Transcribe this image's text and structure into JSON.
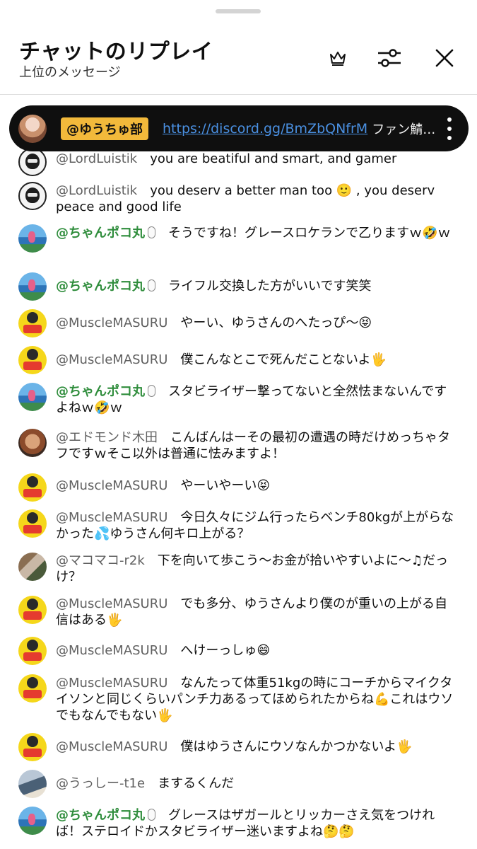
{
  "header": {
    "title": "チャットのリプレイ",
    "subtitle": "上位のメッセージ"
  },
  "pinned": {
    "author": "@ゆうちゅ部",
    "link": "https://discord.gg/BmZbQNfrM",
    "text": "ファン鯖…"
  },
  "messages": [
    {
      "author": "@LordLuistik",
      "text": "you are beatiful and smart, and gamer"
    },
    {
      "author": "@LordLuistik",
      "text": "you deserv a better man too 🙂 , you deserv peace and good life"
    },
    {
      "author": "@ちゃんポコ丸",
      "text": "そうですね！グレースロケランで乙りますｗ🤣ｗ"
    },
    {
      "author": "@ちゃんポコ丸",
      "text": "ライフル交換した方がいいです笑笑"
    },
    {
      "author": "@MuscleMASURU",
      "text": "やーい、ゆうさんのへたっぴ〜😝"
    },
    {
      "author": "@MuscleMASURU",
      "text": "僕こんなとこで死んだことないよ🖐"
    },
    {
      "author": "@ちゃんポコ丸",
      "text": "スタビライザー撃ってないと全然怯まないんですよねｗ🤣ｗ"
    },
    {
      "author": "@エドモンド木田",
      "text": "こんばんはーその最初の遭遇の時だけめっちゃタフですｗそこ以外は普通に怯みますよ！"
    },
    {
      "author": "@MuscleMASURU",
      "text": "やーいやーい😝"
    },
    {
      "author": "@MuscleMASURU",
      "text": "今日久々にジム行ったらベンチ80kgが上がらなかった💦ゆうさん何キロ上がる？"
    },
    {
      "author": "@マコマコ-r2k",
      "text": "下を向いて歩こう〜お金が拾いやすいよに〜♫だっけ？"
    },
    {
      "author": "@MuscleMASURU",
      "text": "でも多分、ゆうさんより僕のが重いの上がる自信はある🖐"
    },
    {
      "author": "@MuscleMASURU",
      "text": "へけーっしゅ😄"
    },
    {
      "author": "@MuscleMASURU",
      "text": "なんたって体重51kgの時にコーチからマイクタイソンと同じくらいパンチ力あるってほめられたからね💪これはウソでもなんでもない🖐"
    },
    {
      "author": "@MuscleMASURU",
      "text": "僕はゆうさんにウソなんかつかないよ🖐"
    },
    {
      "author": "@うっしー-t1e",
      "text": "まするくんだ"
    },
    {
      "author": "@ちゃんポコ丸",
      "text": "グレースはザガールとリッカーさえ気をつければ！ステロイドかスタビライザー迷いますよね🤔🤔"
    }
  ]
}
